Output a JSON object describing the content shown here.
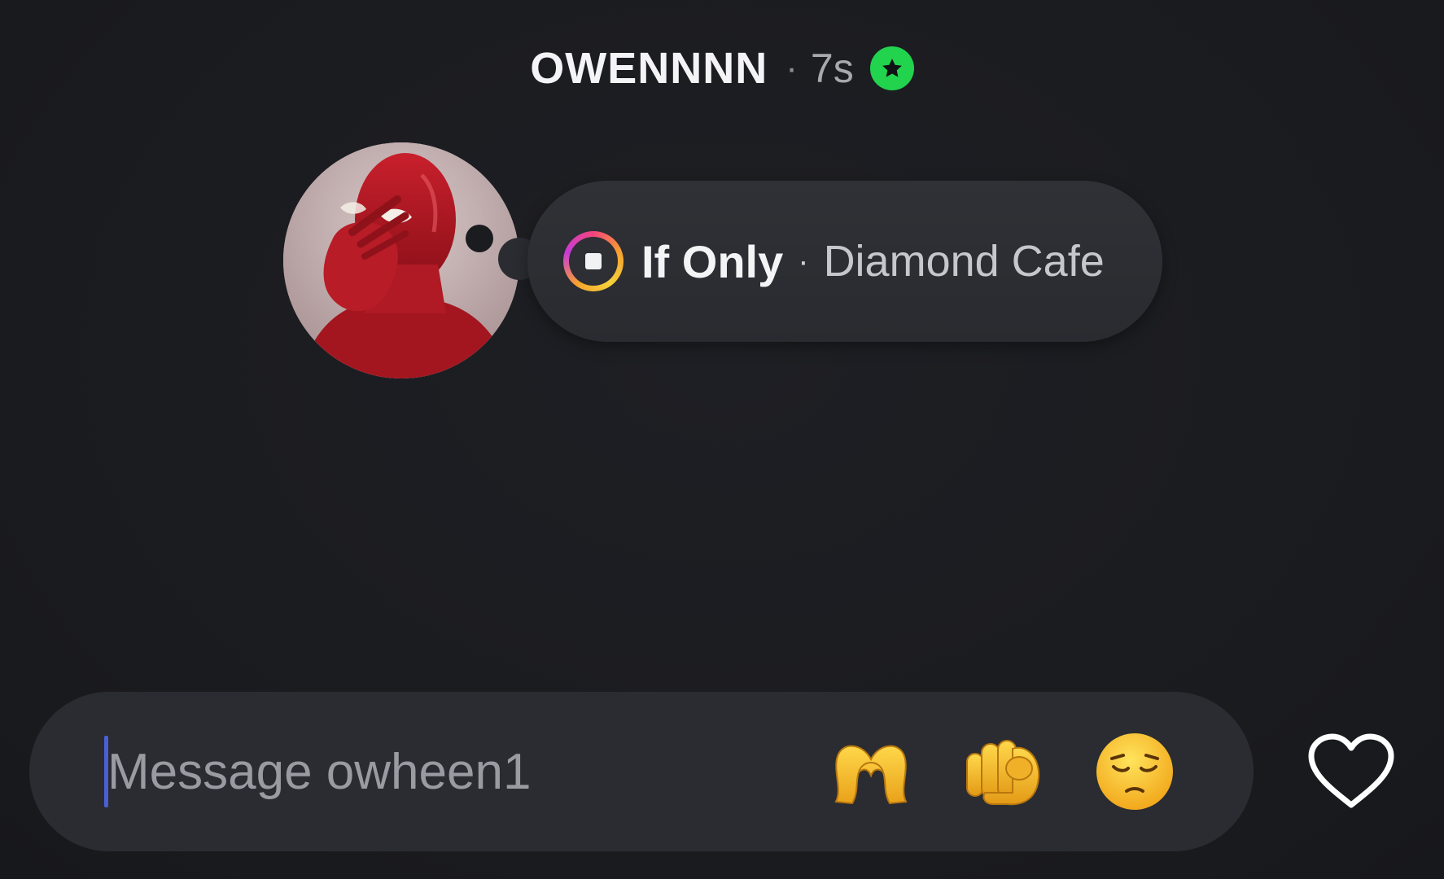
{
  "header": {
    "username": "OWENNNN",
    "separator": "·",
    "time_ago": "7s",
    "badge_icon": "star-icon",
    "badge_color": "#22d34e"
  },
  "profile": {
    "avatar_icon": "spider-mask-avatar"
  },
  "note": {
    "icon": "music-stop-icon",
    "song_title": "If Only",
    "separator": "·",
    "artist": "Diamond Cafe"
  },
  "composer": {
    "placeholder": "Message owheen1",
    "value": "",
    "quick_reactions": [
      {
        "icon": "heart-hands-emoji"
      },
      {
        "icon": "pointing-at-viewer-emoji"
      },
      {
        "icon": "pensive-face-emoji"
      }
    ],
    "like_icon": "heart-outline-icon"
  },
  "colors": {
    "background": "#1b1c20",
    "bubble": "#2a2c31",
    "cursor": "#4a5fd6",
    "badge": "#22d34e"
  }
}
